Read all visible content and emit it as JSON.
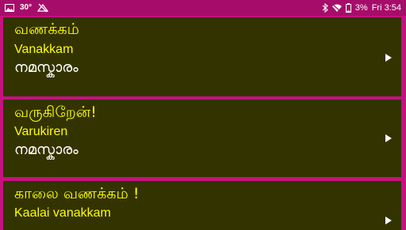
{
  "status_bar": {
    "temperature": "30°",
    "battery_percent": "3%",
    "time": "Fri 3:54",
    "icons": [
      "image-icon",
      "no-sync-icon",
      "bluetooth-icon",
      "wifi-icon",
      "battery-icon"
    ]
  },
  "colors": {
    "background": "#c4127f",
    "status_bar": "#a60d6a",
    "card": "#333300",
    "primary_text": "#ffff00",
    "secondary_text": "#ffffff"
  },
  "phrases": [
    {
      "tamil": "வணக்கம்",
      "transliteration": "Vanakkam",
      "malayalam": "നമസ്കാരം"
    },
    {
      "tamil": "வருகிறேன்!",
      "transliteration": "Varukiren",
      "malayalam": "നമസ്കാരം"
    },
    {
      "tamil": "காலை வணக்கம் !",
      "transliteration": "Kaalai vanakkam",
      "malayalam": ""
    }
  ]
}
